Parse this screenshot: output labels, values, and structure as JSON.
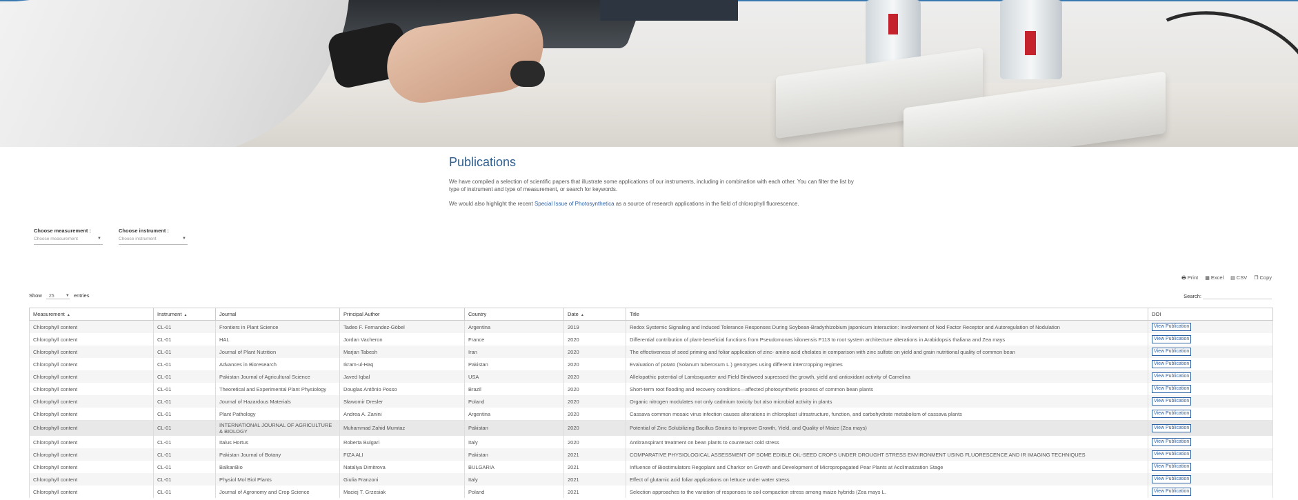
{
  "page": {
    "title": "Publications",
    "intro_p1": "We have compiled a selection of scientific papers that illustrate some applications of our instruments, including in combination with each other. You can filter the list by type of instrument and type of measurement, or search for keywords.",
    "intro_p2_before": "We would also highlight the recent ",
    "intro_p2_link": "Special Issue of Photosynthetica",
    "intro_p2_after": " as a source of research applications in the field of chlorophyll fluorescence."
  },
  "filters": {
    "measurement_label": "Choose measurement :",
    "measurement_placeholder": "Choose measurement",
    "instrument_label": "Choose instrument :",
    "instrument_placeholder": "Choose instrument"
  },
  "exports": {
    "print": "Print",
    "excel": "Excel",
    "csv": "CSV",
    "copy": "Copy"
  },
  "length": {
    "show": "Show",
    "value": "25",
    "entries": "entries"
  },
  "search": {
    "label": "Search:"
  },
  "table": {
    "headers": [
      "Measurement",
      "Instrument",
      "Journal",
      "Principal Author",
      "Country",
      "Date",
      "Title",
      "DOI"
    ],
    "button_label": "View Publication",
    "rows": [
      [
        "Chlorophyll content",
        "CL-01",
        "Frontiers in Plant Science",
        "Tadeo F. Fernandez-Göbel",
        "Argentina",
        "2019",
        "Redox Systemic Signaling and Induced Tolerance Responses During Soybean-Bradyrhizobium japonicum Interaction: Involvement of Nod Factor Receptor and Autoregulation of Nodulation"
      ],
      [
        "Chlorophyll content",
        "CL-01",
        "HAL",
        "Jordan Vacheron",
        "France",
        "2020",
        "Differential contribution of plant-beneficial functions from Pseudomonas kilonensis F113 to root system architecture alterations in Arabidopsis thaliana and Zea mays"
      ],
      [
        "Chlorophyll content",
        "CL-01",
        "Journal of Plant Nutrition",
        "Marjan Tabesh",
        "Iran",
        "2020",
        "The effectiveness of seed priming and foliar application of zinc- amino acid chelates in comparison with zinc sulfate on yield and grain nutritional quality of common bean"
      ],
      [
        "Chlorophyll content",
        "CL-01",
        "Advances in Bioresearch",
        "Ikram-ul-Haq",
        "Pakistan",
        "2020",
        "Evaluation of potato (Solanum tuberosum L.) genotypes using different intercropping regimes"
      ],
      [
        "Chlorophyll content",
        "CL-01",
        "Pakistan Journal of Agricultural Science",
        "Javed Iqbal",
        "USA",
        "2020",
        "Allelopathic potential of Lambsquarter and Field Bindweed supressed the growth, yield and antioxidant activity of Camelina"
      ],
      [
        "Chlorophyll content",
        "CL-01",
        "Theoretical and Experimental Plant Physiology",
        "Douglas Antônio Posso",
        "Brazil",
        "2020",
        "Short-term root flooding and recovery conditions—affected photosynthetic process of common bean plants"
      ],
      [
        "Chlorophyll content",
        "CL-01",
        "Journal of Hazardous Materials",
        "Sławomir Dresler",
        "Poland",
        "2020",
        "Organic nitrogen modulates not only cadmium toxicity but also microbial activity in plants"
      ],
      [
        "Chlorophyll content",
        "CL-01",
        "Plant Pathology",
        "Andrea A. Zanini",
        "Argentina",
        "2020",
        "Cassava common mosaic virus infection causes alterations in chloroplast ultrastructure, function, and carbohydrate metabolism of cassava plants"
      ],
      [
        "Chlorophyll content",
        "CL-01",
        "INTERNATIONAL JOURNAL OF AGRICULTURE & BIOLOGY",
        "Muhammad Zahid Mumtaz",
        "Pakistan",
        "2020",
        "Potential of Zinc Solubilizing Bacillus Strains to Improve Growth, Yield, and Quality of Maize (Zea mays)"
      ],
      [
        "Chlorophyll content",
        "CL-01",
        "Italus Hortus",
        "Roberta Bulgari",
        "Italy",
        "2020",
        "Antitranspirant treatment on bean plants to counteract cold stress"
      ],
      [
        "Chlorophyll content",
        "CL-01",
        "Pakistan Journal of Botany",
        "FIZA ALI",
        "Pakistan",
        "2021",
        "COMPARATIVE PHYSIOLOGICAL ASSESSMENT OF SOME EDIBLE OIL-SEED CROPS UNDER DROUGHT STRESS ENVIRONMENT USING FLUORESCENCE AND IR IMAGING TECHNIQUES"
      ],
      [
        "Chlorophyll content",
        "CL-01",
        "BalkanBio",
        "Nataliya Dimitrova",
        "BULGARIA",
        "2021",
        "Influence of Biostimulators Regoplant and Charkor on Growth and Development of Micropropagated Pear Plants at Acclimatization Stage"
      ],
      [
        "Chlorophyll content",
        "CL-01",
        "Physiol Mol Biol Plants",
        "Giulia Franzoni",
        "Italy",
        "2021",
        "Effect of glutamic acid foliar applications on lettuce under water stress"
      ],
      [
        "Chlorophyll content",
        "CL-01",
        "Journal of Agronomy and Crop Science",
        "Maciej T. Grzesiak",
        "Poland",
        "2021",
        "Selection approaches to the variation of responses to soil compaction stress among maize hybrids (Zea mays L."
      ]
    ]
  }
}
